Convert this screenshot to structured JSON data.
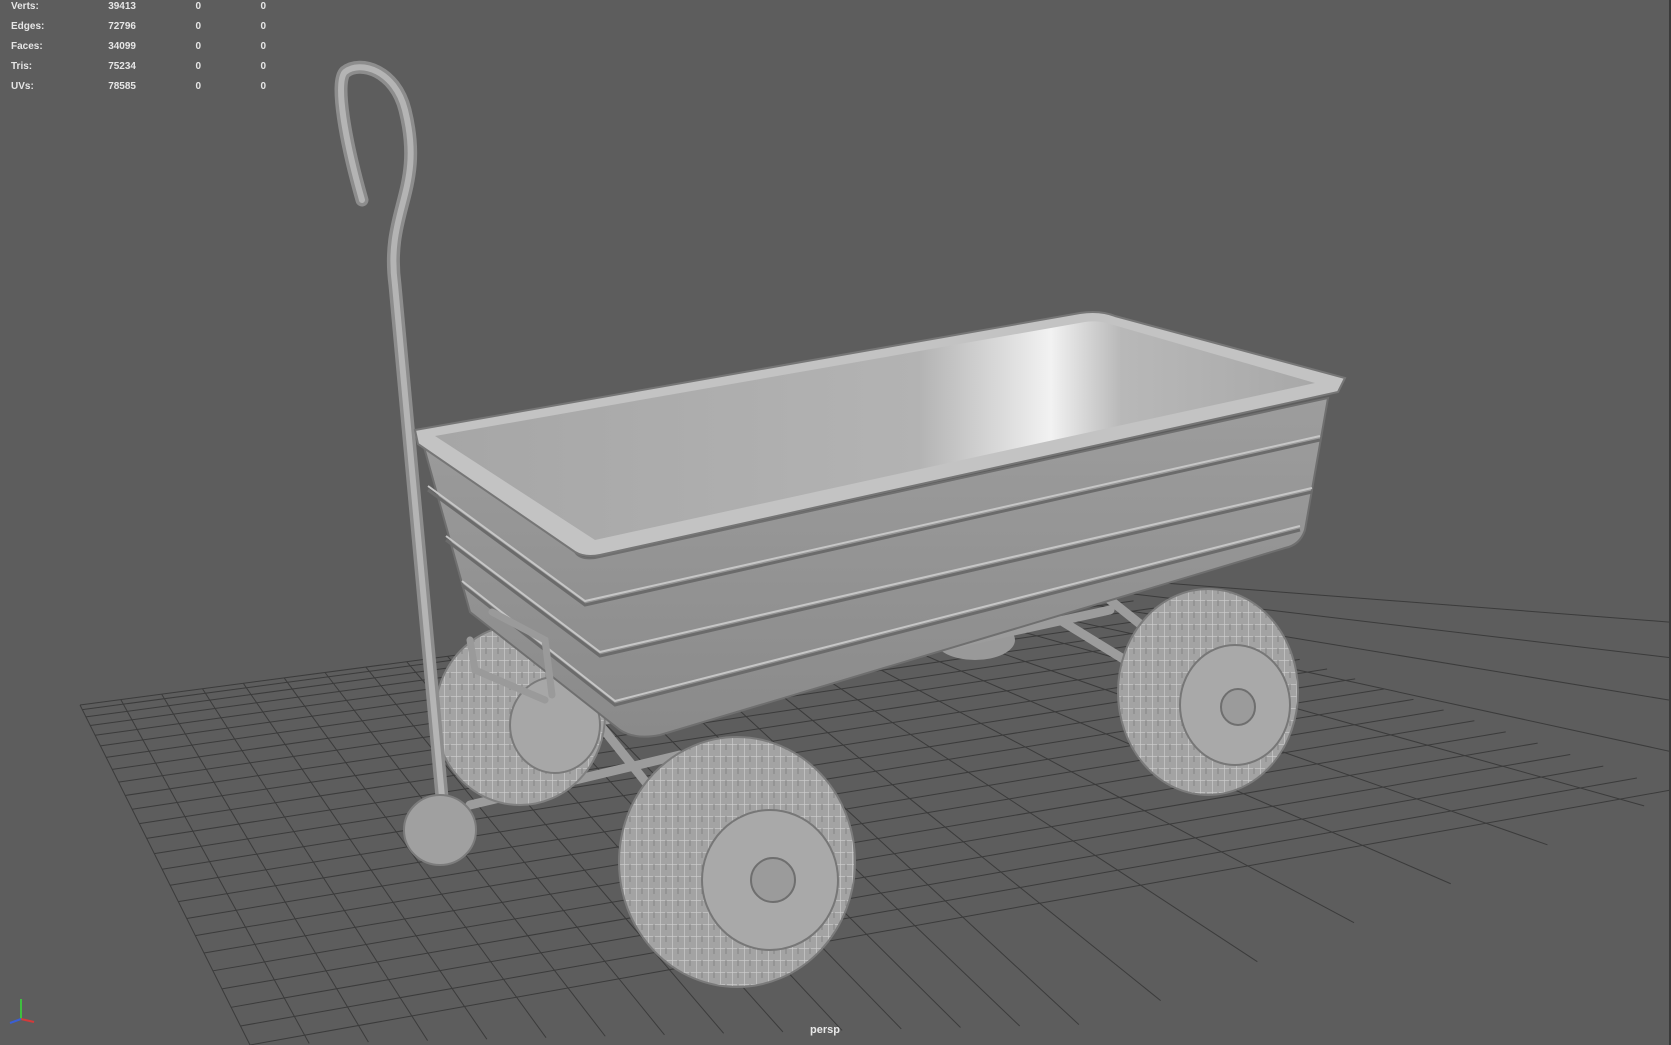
{
  "stats": {
    "rows": [
      {
        "label": "Verts:",
        "values": [
          "39413",
          "0",
          "0"
        ]
      },
      {
        "label": "Edges:",
        "values": [
          "72796",
          "0",
          "0"
        ]
      },
      {
        "label": "Faces:",
        "values": [
          "34099",
          "0",
          "0"
        ]
      },
      {
        "label": "Tris:",
        "values": [
          "75234",
          "0",
          "0"
        ]
      },
      {
        "label": "UVs:",
        "values": [
          "78585",
          "0",
          "0"
        ]
      }
    ]
  },
  "camera": {
    "name": "persp"
  },
  "colors": {
    "background": "#5d5d5d",
    "grid": "#3b3b3b",
    "model_light": "#b9b9b9",
    "model_mid": "#a2a2a2",
    "model_dark": "#858585",
    "axis_x": "#d43a3a",
    "axis_y": "#3fbf3f",
    "axis_z": "#3a5fd4"
  },
  "icons": {
    "axis": "axis-gizmo-icon"
  }
}
